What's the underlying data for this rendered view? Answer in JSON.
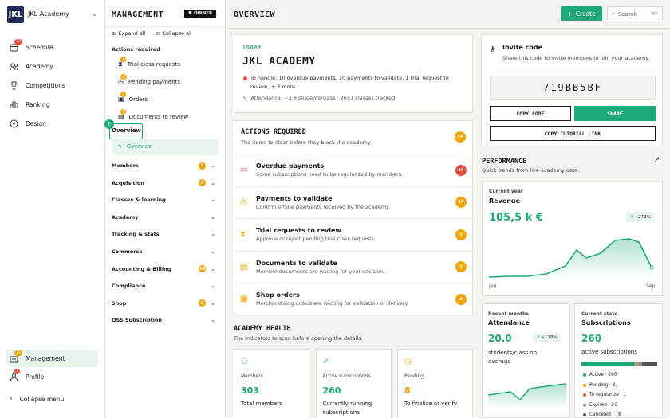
{
  "nav": {
    "logo": "JKL",
    "app_name": "JKL Academy",
    "items": [
      {
        "label": "Schedule",
        "badge": "30",
        "icon": "calendar-icon"
      },
      {
        "label": "Academy",
        "icon": "people-icon"
      },
      {
        "label": "Competitions",
        "icon": "trophy-icon"
      },
      {
        "label": "Ranking",
        "icon": "ranking-icon"
      },
      {
        "label": "Design",
        "icon": "palette-icon"
      }
    ],
    "management": {
      "label": "Management",
      "badge": "13"
    },
    "profile": {
      "label": "Profile",
      "badge": "1"
    },
    "collapse": "Collapse menu"
  },
  "mgmt": {
    "title": "MANAGEMENT",
    "owner": "OWNER",
    "expand_all": "Expand all",
    "collapse_all": "Collapse all",
    "actions_required": "Actions required",
    "actions": [
      {
        "label": "Trial class requests",
        "badge": "1"
      },
      {
        "label": "Pending payments",
        "badge": "10"
      },
      {
        "label": "Orders",
        "badge": "2"
      },
      {
        "label": "Documents to review",
        "badge": "1"
      }
    ],
    "step": "1",
    "overview": "Overview",
    "overview_sub": "Overview",
    "groups": [
      {
        "label": "Members",
        "badge": "1"
      },
      {
        "label": "Acquisition",
        "badge": "1"
      },
      {
        "label": "Classes & learning",
        "badge": ""
      },
      {
        "label": "Academy",
        "badge": ""
      },
      {
        "label": "Tracking & stats",
        "badge": ""
      },
      {
        "label": "Commerce",
        "badge": ""
      },
      {
        "label": "Accounting & Billing",
        "badge": "10"
      },
      {
        "label": "Compliance",
        "badge": ""
      },
      {
        "label": "Shop",
        "badge": "2"
      },
      {
        "label": "OSS Subscription",
        "badge": ""
      }
    ]
  },
  "header": {
    "title": "OVERVIEW",
    "create": "Create",
    "search": "Search",
    "shortcut": "⌘K"
  },
  "today": {
    "eyebrow": "TODAY",
    "title": "JKL ACADEMY",
    "handle": "To handle: 10 overdue payments, 10 payments to validate, 1 trial request to review, + 3 more.",
    "attendance": "Attendance: ~3.8 students/class · 2651 classes tracked"
  },
  "actions": {
    "title": "ACTIONS REQUIRED",
    "subtitle": "The items to clear before they block the academy.",
    "count": "24",
    "rows": [
      {
        "title": "Overdue payments",
        "sub": "Some subscriptions need to be regularized by members.",
        "badge": "10",
        "color": "#e84b3c"
      },
      {
        "title": "Payments to validate",
        "sub": "Confirm offline payments received by the academy.",
        "badge": "10",
        "color": "#f0a500"
      },
      {
        "title": "Trial requests to review",
        "sub": "Approve or reject pending trial class requests.",
        "badge": "1",
        "color": "#f0a500"
      },
      {
        "title": "Documents to validate",
        "sub": "Member documents are waiting for your decision.",
        "badge": "1",
        "color": "#f0a500"
      },
      {
        "title": "Shop orders",
        "sub": "Merchandising orders are waiting for validation or delivery.",
        "badge": "2",
        "color": "#f0a500"
      }
    ]
  },
  "health": {
    "title": "ACADEMY HEALTH",
    "subtitle": "The indicators to scan before opening the details.",
    "cards": [
      {
        "label": "Members",
        "value": "303",
        "desc": "Total members"
      },
      {
        "label": "Active subscriptions",
        "value": "260",
        "desc": "Currently running subscriptions"
      },
      {
        "label": "Pending",
        "value": "8",
        "desc": "To finalize or verify"
      }
    ]
  },
  "invite": {
    "title": "Invite code",
    "desc": "Share this code to invite members to join your academy.",
    "code": "719BB5BF",
    "copy": "COPY CODE",
    "share": "SHARE",
    "tutorial": "COPY TUTORIAL LINK"
  },
  "performance": {
    "title": "PERFORMANCE",
    "subtitle": "Quick trends from live academy data.",
    "revenue": {
      "eyebrow": "Current year",
      "label": "Revenue",
      "value": "105,5 k €",
      "delta": "+272%",
      "start": "Jan",
      "end": "Sep"
    },
    "attendance": {
      "eyebrow": "Recent months",
      "label": "Attendance",
      "value": "20.0",
      "delta": "+178%",
      "desc": "students/class on average"
    },
    "subs": {
      "eyebrow": "Current state",
      "label": "Subscriptions",
      "value": "260",
      "desc": "active subscriptions",
      "legend": [
        {
          "label": "Active · 260",
          "color": "#1fa97b"
        },
        {
          "label": "Pending · 8",
          "color": "#f0a500"
        },
        {
          "label": "To regularize · 1",
          "color": "#e84b3c"
        },
        {
          "label": "Expired · 26",
          "color": "#999999"
        },
        {
          "label": "Canceled · 78",
          "color": "#555555"
        }
      ]
    }
  },
  "colors": {
    "accent": "#1fa97b",
    "warning": "#f0a500",
    "danger": "#e84b3c"
  }
}
